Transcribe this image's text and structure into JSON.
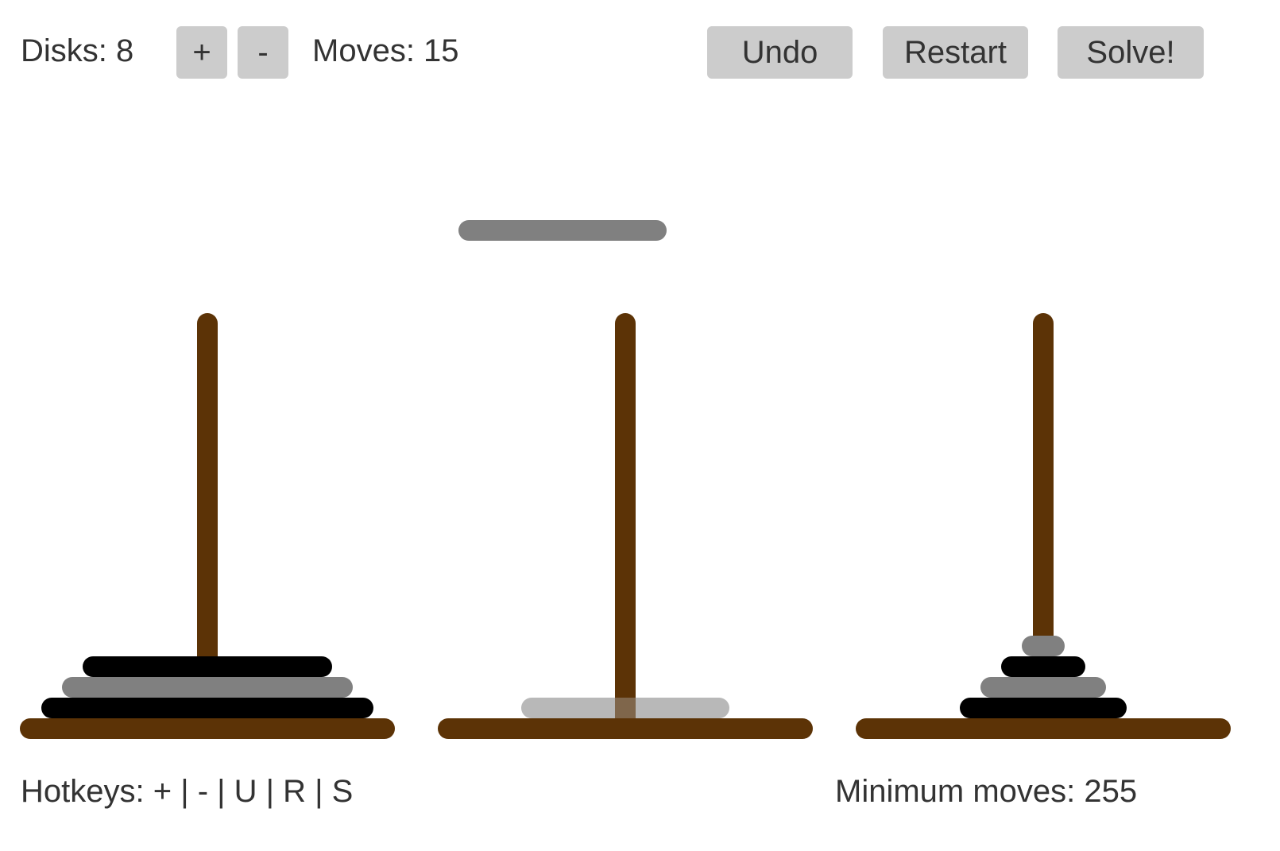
{
  "toolbar": {
    "disks_text": "Disks: 8",
    "increase_label": "+",
    "decrease_label": "-",
    "moves_text": "Moves: 15",
    "undo_label": "Undo",
    "restart_label": "Restart",
    "solve_label": "Solve!"
  },
  "footer": {
    "hotkeys_text": "Hotkeys: + | - | U | R | S",
    "minimum_moves_text": "Minimum moves: 255"
  },
  "game": {
    "total_disks": 8,
    "moves": 15,
    "minimum_moves": 255,
    "held_disk": {
      "size": 5,
      "color": "#808080"
    },
    "pegs": [
      {
        "name": "peg-left",
        "disks": [
          {
            "size": 8,
            "color": "#000000"
          },
          {
            "size": 7,
            "color": "#808080"
          },
          {
            "size": 6,
            "color": "#000000"
          }
        ]
      },
      {
        "name": "peg-middle",
        "disks": []
      },
      {
        "name": "peg-right",
        "disks": [
          {
            "size": 4,
            "color": "#000000"
          },
          {
            "size": 3,
            "color": "#808080"
          },
          {
            "size": 2,
            "color": "#000000"
          },
          {
            "size": 1,
            "color": "#808080"
          }
        ]
      }
    ],
    "drop_preview": {
      "peg": 1,
      "size": 5,
      "color": "#b0b0b0"
    }
  },
  "colors": {
    "wood": "#5c3306",
    "button_bg": "#cccccc",
    "text": "#333333"
  }
}
